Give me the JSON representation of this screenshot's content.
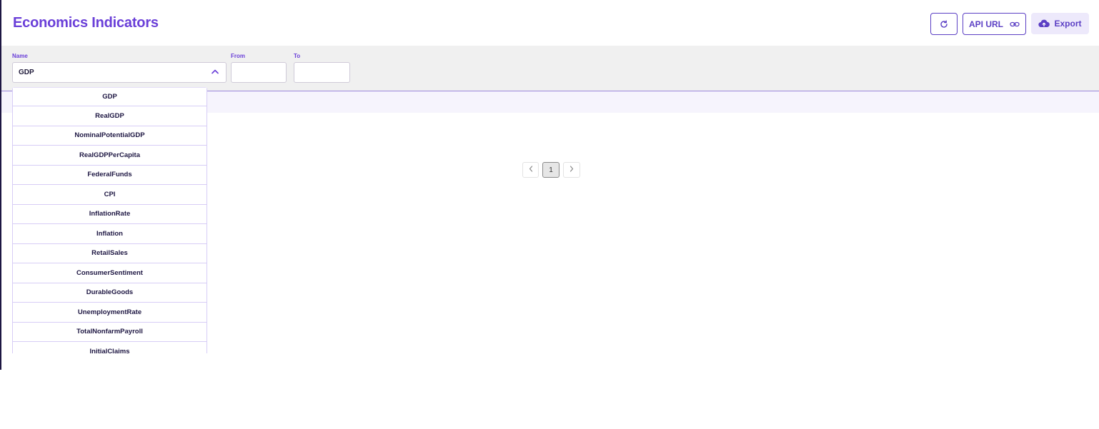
{
  "header": {
    "title": "Economics Indicators",
    "api_url_label": "API URL",
    "export_label": "Export"
  },
  "filters": {
    "name_label": "Name",
    "name_value": "GDP",
    "from_label": "From",
    "from_value": "",
    "to_label": "To",
    "to_value": ""
  },
  "dropdown": {
    "options": [
      "GDP",
      "RealGDP",
      "NominalPotentialGDP",
      "RealGDPPerCapita",
      "FederalFunds",
      "CPI",
      "InflationRate",
      "Inflation",
      "RetailSales",
      "ConsumerSentiment",
      "DurableGoods",
      "UnemploymentRate",
      "TotalNonfarmPayroll",
      "InitialClaims"
    ]
  },
  "pagination": {
    "current_page": "1"
  },
  "colors": {
    "accent": "#6a3fd8",
    "button_border": "#5b3fc4",
    "export_bg": "#ede9fb"
  },
  "icons": {
    "refresh": "refresh-icon",
    "link": "link-icon",
    "export": "cloud-upload-icon",
    "caret": "chevron-up-icon",
    "prev": "chevron-left-icon",
    "next": "chevron-right-icon"
  }
}
